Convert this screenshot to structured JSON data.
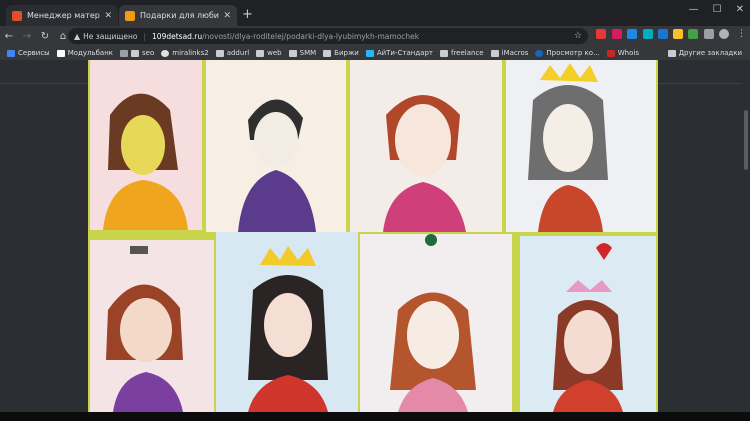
{
  "tabs": [
    {
      "title": "Менеджер материалов",
      "active": false
    },
    {
      "title": "Подарки для любимых",
      "active": true
    }
  ],
  "toolbar": {
    "security_label": "Не защищено",
    "url_host": "109detsad.ru",
    "url_path": "/novosti/dlya-roditelej/podarki-dlya-lyubimykh-mamochek"
  },
  "bookmarks": [
    "Сервисы",
    "Модульбанк",
    "seo",
    "miralinks2",
    "addurl",
    "web",
    "SMM",
    "Биржи",
    "АйТи-Стандарт",
    "freelance",
    "iMacros",
    "Просмотр ко...",
    "Whois"
  ],
  "bookmarks_other": "Другие закладки",
  "colors": {
    "tabstrip": "#1f2124",
    "toolbar": "#35373a",
    "page_bg": "#2b2f33"
  }
}
